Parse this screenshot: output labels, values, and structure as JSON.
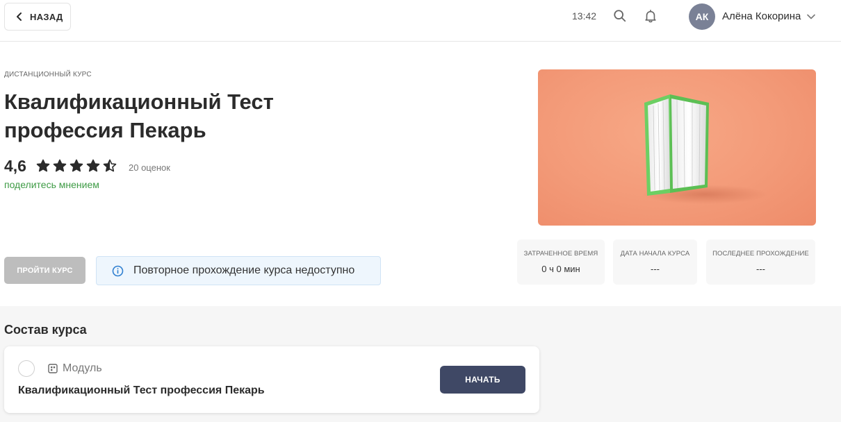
{
  "header": {
    "back_label": "НАЗАД",
    "time": "13:42",
    "user": {
      "initials": "АК",
      "name": "Алёна Кокорина"
    }
  },
  "course": {
    "kicker": "ДИСТАНЦИОННЫЙ КУРС",
    "title": "Квалификационный Тест профессия Пекарь",
    "rating": "4,6",
    "rating_value": 4.6,
    "stars_total": 5,
    "reviews": "20 оценок",
    "share_link": "поделитесь мнением",
    "start_button": "ПРОЙТИ КУРС",
    "notice": "Повторное прохождение курса недоступно"
  },
  "stats": [
    {
      "label": "ЗАТРАЧЕННОЕ ВРЕМЯ",
      "value": "0 ч 0 мин"
    },
    {
      "label": "ДАТА НАЧАЛА КУРСА",
      "value": "---"
    },
    {
      "label": "ПОСЛЕДНЕЕ ПРОХОЖДЕНИЕ",
      "value": "---"
    }
  ],
  "composition": {
    "title": "Состав курса",
    "items": [
      {
        "type": "Модуль",
        "name": "Квалификационный Тест профессия Пекарь",
        "action": "НАЧАТЬ"
      }
    ]
  },
  "colors": {
    "accent_green": "#3e9b45",
    "primary_button": "#3f4865",
    "disabled_button": "#bdbdbd",
    "hero_background": "#f39a78"
  }
}
